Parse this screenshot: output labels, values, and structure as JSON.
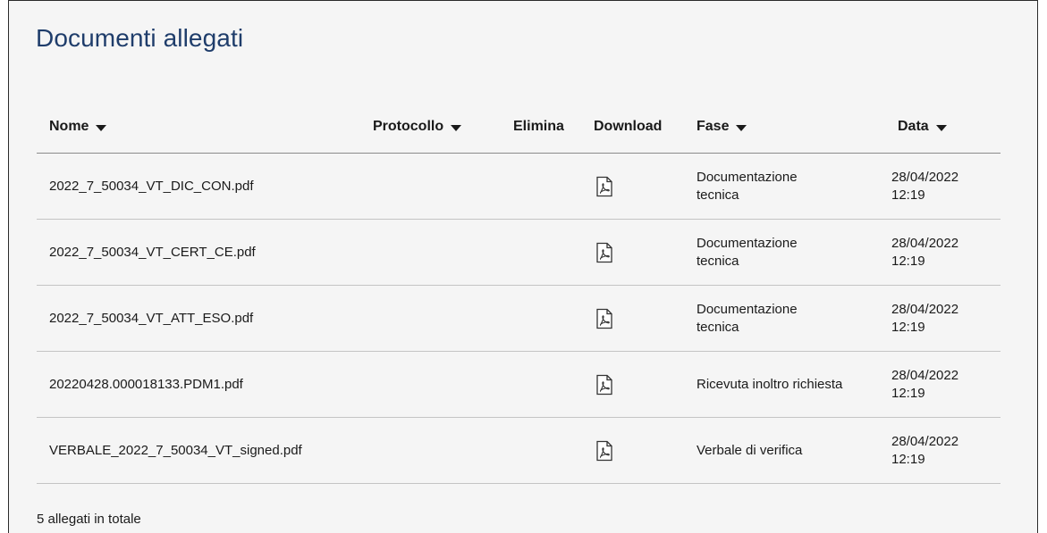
{
  "panel": {
    "title": "Documenti allegati"
  },
  "table": {
    "headers": {
      "nome": "Nome",
      "protocollo": "Protocollo",
      "elimina": "Elimina",
      "download": "Download",
      "fase": "Fase",
      "data": "Data"
    },
    "rows": [
      {
        "name": "2022_7_50034_VT_DIC_CON.pdf",
        "fase_line1": "Documentazione",
        "fase_line2": "tecnica",
        "date": "28/04/2022",
        "time": "12:19"
      },
      {
        "name": "2022_7_50034_VT_CERT_CE.pdf",
        "fase_line1": "Documentazione",
        "fase_line2": "tecnica",
        "date": "28/04/2022",
        "time": "12:19"
      },
      {
        "name": "2022_7_50034_VT_ATT_ESO.pdf",
        "fase_line1": "Documentazione",
        "fase_line2": "tecnica",
        "date": "28/04/2022",
        "time": "12:19"
      },
      {
        "name": "20220428.000018133.PDM1.pdf",
        "fase_line1": "Ricevuta inoltro richiesta",
        "fase_line2": "",
        "date": "28/04/2022",
        "time": "12:19"
      },
      {
        "name": "VERBALE_2022_7_50034_VT_signed.pdf",
        "fase_line1": "Verbale di verifica",
        "fase_line2": "",
        "date": "28/04/2022",
        "time": "12:19"
      }
    ]
  },
  "footer": {
    "total_text": "5 allegati in totale"
  },
  "icons": {
    "sort": "caret-down-icon",
    "download": "pdf-file-icon"
  },
  "colors": {
    "title": "#1f3d6b",
    "panel_bg": "#f5f5f5"
  }
}
